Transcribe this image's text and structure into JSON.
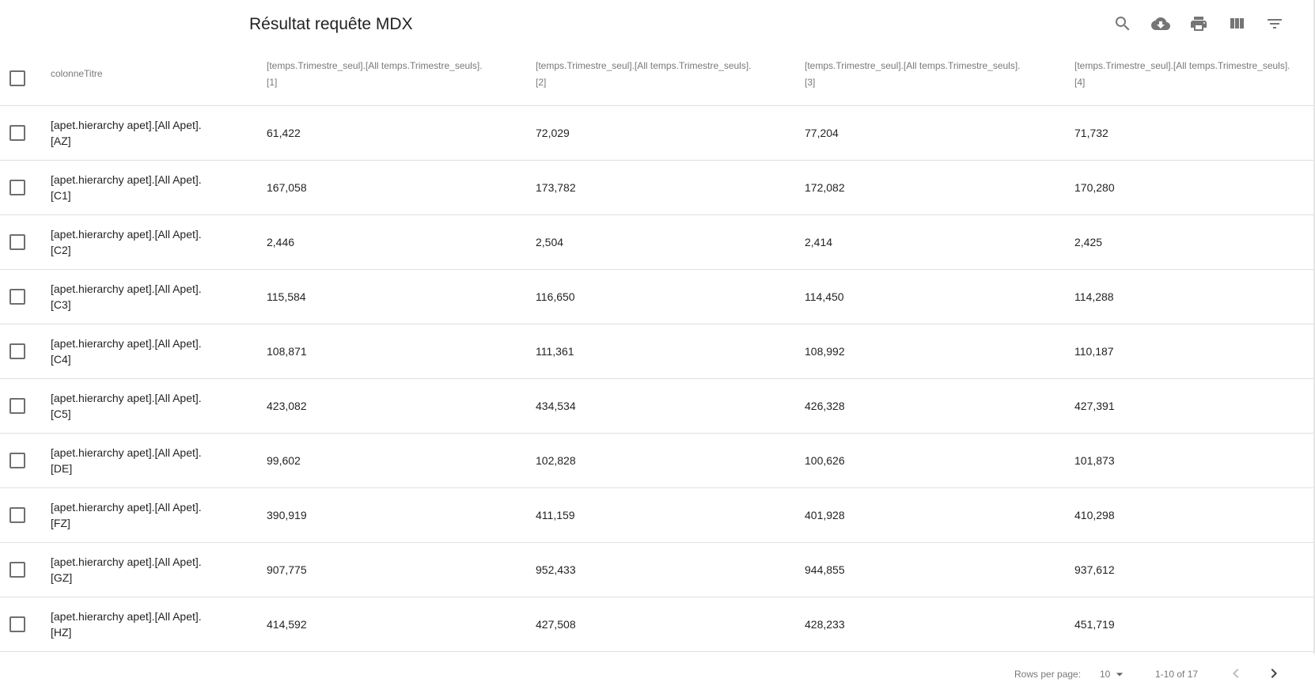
{
  "toolbar": {
    "title": "Résultat requête MDX",
    "icons": [
      "search-icon",
      "download-icon",
      "print-icon",
      "view-columns-icon",
      "filter-icon"
    ]
  },
  "table": {
    "columns": [
      "colonneTitre",
      "[temps.Trimestre_seul].[All temps.Trimestre_seuls].[1]",
      "[temps.Trimestre_seul].[All temps.Trimestre_seuls].[2]",
      "[temps.Trimestre_seul].[All temps.Trimestre_seuls].[3]",
      "[temps.Trimestre_seul].[All temps.Trimestre_seuls].[4]"
    ],
    "column_lines": [
      [
        "colonneTitre",
        ""
      ],
      [
        "[temps.Trimestre_seul].[All temps.Trimestre_seuls].",
        "[1]"
      ],
      [
        "[temps.Trimestre_seul].[All temps.Trimestre_seuls].",
        "[2]"
      ],
      [
        "[temps.Trimestre_seul].[All temps.Trimestre_seuls].",
        "[3]"
      ],
      [
        "[temps.Trimestre_seul].[All temps.Trimestre_seuls].",
        "[4]"
      ]
    ],
    "rows": [
      {
        "title_line1": "[apet.hierarchy apet].[All Apet].",
        "title_line2": "[AZ]",
        "values": [
          "61,422",
          "72,029",
          "77,204",
          "71,732"
        ]
      },
      {
        "title_line1": "[apet.hierarchy apet].[All Apet].",
        "title_line2": "[C1]",
        "values": [
          "167,058",
          "173,782",
          "172,082",
          "170,280"
        ]
      },
      {
        "title_line1": "[apet.hierarchy apet].[All Apet].",
        "title_line2": "[C2]",
        "values": [
          "2,446",
          "2,504",
          "2,414",
          "2,425"
        ]
      },
      {
        "title_line1": "[apet.hierarchy apet].[All Apet].",
        "title_line2": "[C3]",
        "values": [
          "115,584",
          "116,650",
          "114,450",
          "114,288"
        ]
      },
      {
        "title_line1": "[apet.hierarchy apet].[All Apet].",
        "title_line2": "[C4]",
        "values": [
          "108,871",
          "111,361",
          "108,992",
          "110,187"
        ]
      },
      {
        "title_line1": "[apet.hierarchy apet].[All Apet].",
        "title_line2": "[C5]",
        "values": [
          "423,082",
          "434,534",
          "426,328",
          "427,391"
        ]
      },
      {
        "title_line1": "[apet.hierarchy apet].[All Apet].",
        "title_line2": "[DE]",
        "values": [
          "99,602",
          "102,828",
          "100,626",
          "101,873"
        ]
      },
      {
        "title_line1": "[apet.hierarchy apet].[All Apet].",
        "title_line2": "[FZ]",
        "values": [
          "390,919",
          "411,159",
          "401,928",
          "410,298"
        ]
      },
      {
        "title_line1": "[apet.hierarchy apet].[All Apet].",
        "title_line2": "[GZ]",
        "values": [
          "907,775",
          "952,433",
          "944,855",
          "937,612"
        ]
      },
      {
        "title_line1": "[apet.hierarchy apet].[All Apet].",
        "title_line2": "[HZ]",
        "values": [
          "414,592",
          "427,508",
          "428,233",
          "451,719"
        ]
      }
    ]
  },
  "footer": {
    "rows_per_page_label": "Rows per page:",
    "rows_per_page_value": "10",
    "range_text": "1-10 of 17",
    "prev_icon": "chevron-left-icon",
    "next_icon": "chevron-right-icon"
  },
  "colors": {
    "icon": "#757575",
    "divider": "#e0e0e0",
    "nav_disabled": "#bdbdbd",
    "nav_enabled": "#424242"
  }
}
